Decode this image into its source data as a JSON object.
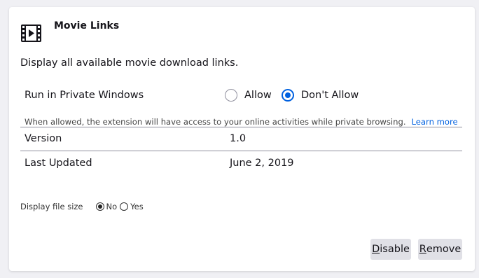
{
  "addon": {
    "icon": "film-icon",
    "name": "Movie Links",
    "description": "Display all available movie download links."
  },
  "private_windows": {
    "label": "Run in Private Windows",
    "options": [
      {
        "label": "Allow",
        "selected": false
      },
      {
        "label": "Don't Allow",
        "selected": true
      }
    ],
    "help_text": "When allowed, the extension will have access to your online activities while private browsing.",
    "learn_more": "Learn more"
  },
  "details": {
    "version_label": "Version",
    "version_value": "1.0",
    "updated_label": "Last Updated",
    "updated_value": "June 2, 2019"
  },
  "prefs": {
    "file_size_label": "Display file size",
    "options": [
      {
        "label": "No",
        "selected": true
      },
      {
        "label": "Yes",
        "selected": false
      }
    ]
  },
  "buttons": {
    "disable_access": "D",
    "disable_rest": "isable",
    "remove_access": "R",
    "remove_rest": "emove"
  },
  "colors": {
    "accent": "#0061e0",
    "background": "#f0f0f4",
    "button": "#e0e0e6"
  }
}
